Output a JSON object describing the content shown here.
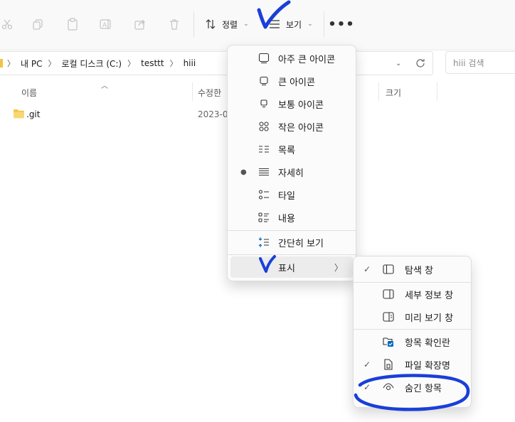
{
  "toolbar": {
    "sort_label": "정렬",
    "view_label": "보기",
    "more_label": "•••",
    "icons": [
      "cut-icon",
      "copy-icon",
      "paste-icon",
      "rename-icon",
      "share-icon",
      "delete-icon"
    ]
  },
  "address": {
    "crumbs": [
      "내 PC",
      "로컬 디스크 (C:)",
      "testtt",
      "hiii"
    ],
    "search_placeholder": "hiii 검색"
  },
  "columns": {
    "name": "이름",
    "modified": "수정한",
    "size": "크기"
  },
  "files": [
    {
      "name": ".git",
      "modified": "2023-0"
    }
  ],
  "view_menu": {
    "items": [
      {
        "label": "아주 큰 아이콘",
        "icon": "extra-large-icons-icon"
      },
      {
        "label": "큰 아이콘",
        "icon": "large-icons-icon"
      },
      {
        "label": "보통 아이콘",
        "icon": "medium-icons-icon"
      },
      {
        "label": "작은 아이콘",
        "icon": "small-icons-icon"
      },
      {
        "label": "목록",
        "icon": "list-icon"
      },
      {
        "label": "자세히",
        "icon": "details-icon",
        "selected": true
      },
      {
        "label": "타일",
        "icon": "tiles-icon"
      },
      {
        "label": "내용",
        "icon": "content-icon"
      }
    ],
    "compact_label": "간단히 보기",
    "show_label": "표시"
  },
  "show_submenu": {
    "items": [
      {
        "label": "탐색 창",
        "checked": true,
        "icon": "navigation-pane-icon"
      },
      {
        "label": "세부 정보 창",
        "checked": false,
        "icon": "details-pane-icon"
      },
      {
        "label": "미리 보기 창",
        "checked": false,
        "icon": "preview-pane-icon"
      },
      {
        "label": "항목 확인란",
        "checked": false,
        "icon": "item-checkbox-icon"
      },
      {
        "label": "파일 확장명",
        "checked": true,
        "icon": "file-extension-icon"
      },
      {
        "label": "숨긴 항목",
        "checked": true,
        "icon": "hidden-items-icon"
      }
    ]
  },
  "colors": {
    "accent": "#0067c0",
    "annotation": "#1a3fd8",
    "folder": "#f3c443"
  }
}
